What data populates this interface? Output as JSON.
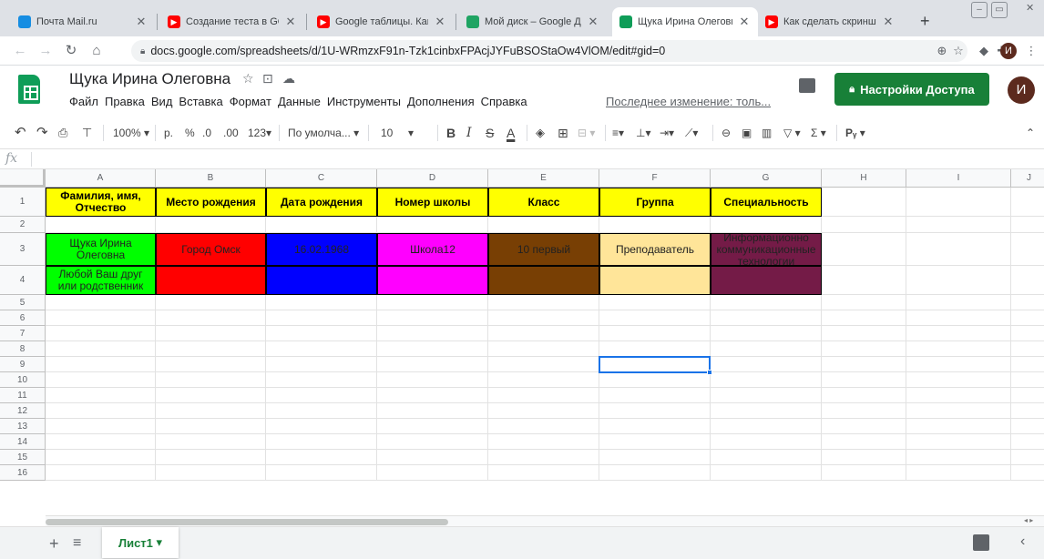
{
  "browser": {
    "tabs": [
      {
        "title": "Почта Mail.ru",
        "icon": "mail-icon",
        "color": "#168de2",
        "active": false
      },
      {
        "title": "Создание теста в GOOGLE",
        "icon": "youtube-icon",
        "color": "#ff0000",
        "active": false
      },
      {
        "title": "Google таблицы. Как созд",
        "icon": "youtube-icon",
        "color": "#ff0000",
        "active": false
      },
      {
        "title": "Мой диск – Google Диск",
        "icon": "google-drive-icon",
        "color": "#1fa463",
        "active": false
      },
      {
        "title": "Щука Ирина Олеговна - G",
        "icon": "google-sheets-icon",
        "color": "#0f9d58",
        "active": true
      },
      {
        "title": "Как сделать скриншот на",
        "icon": "youtube-icon",
        "color": "#ff0000",
        "active": false
      }
    ],
    "url": "docs.google.com/spreadsheets/d/1U-WRmzxF91n-Tzk1cinbxFPAcjJYFuBSOStaOw4VlOM/edit#gid=0",
    "profile_initial": "И"
  },
  "doc": {
    "title": "Щука Ирина Олеговна",
    "menu": [
      "Файл",
      "Правка",
      "Вид",
      "Вставка",
      "Формат",
      "Данные",
      "Инструменты",
      "Дополнения",
      "Справка"
    ],
    "last_edit": "Последнее изменение: толь...",
    "share_label": "Настройки Доступа",
    "avatar_initial": "И"
  },
  "toolbar": {
    "zoom": "100%",
    "currency": "р.",
    "percent": "%",
    "dec_less": ".0",
    "dec_more": ".00",
    "format_more": "123",
    "font": "По умолча...",
    "font_size": "10"
  },
  "grid": {
    "columns": [
      "A",
      "B",
      "C",
      "D",
      "E",
      "F",
      "G",
      "H",
      "I",
      "J"
    ],
    "rows": [
      "1",
      "2",
      "3",
      "4",
      "5",
      "6",
      "7",
      "8",
      "9",
      "10",
      "11",
      "12",
      "13",
      "14",
      "15",
      "16"
    ],
    "headers": [
      "Фамилия, имя, Отчество",
      "Место рождения",
      "Дата рождения",
      "Номер школы",
      "Класс",
      "Группа",
      "Специальность"
    ],
    "header_color": "#ffff00",
    "row3": [
      "Щука Ирина Олеговна",
      "Город Омск",
      "16.02.1968",
      "Школа12",
      "10 первый",
      "Преподаватель",
      "Информационно коммуникационные технологии"
    ],
    "row4": [
      "Любой Ваш друг или родственник",
      "",
      "",
      "",
      "",
      "",
      ""
    ],
    "fill_colors": [
      "#00ff00",
      "#ff0000",
      "#0000ff",
      "#ff00ff",
      "#783f04",
      "#ffe599",
      "#741b47"
    ],
    "selected_cell": "F9"
  },
  "sheets": {
    "tabs": [
      "Лист1"
    ]
  }
}
